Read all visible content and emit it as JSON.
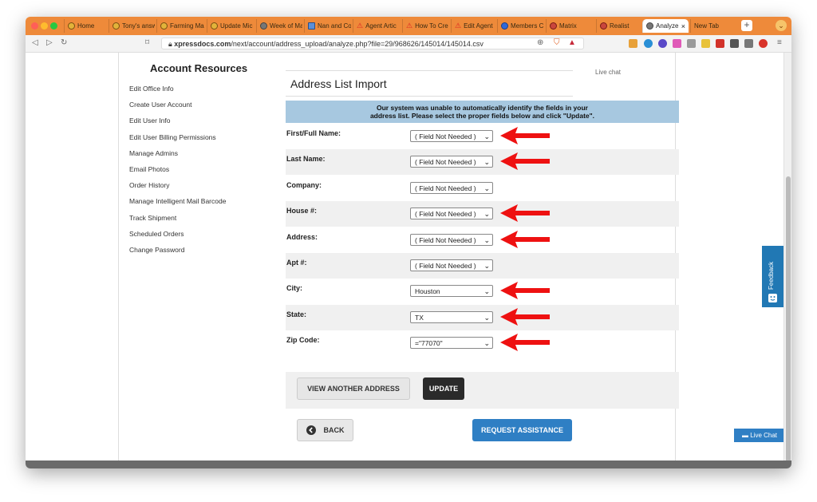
{
  "browser": {
    "tabs": [
      {
        "label": "Home",
        "icon": "chrome-icon"
      },
      {
        "label": "Tony's answ",
        "icon": "smiley-icon"
      },
      {
        "label": "Farming Ma",
        "icon": "chrome-icon"
      },
      {
        "label": "Update Mic",
        "icon": "chrome-icon"
      },
      {
        "label": "Week of Ma",
        "icon": "gear-icon"
      },
      {
        "label": "Nan and Co",
        "icon": "doc-icon"
      },
      {
        "label": "Agent Artic",
        "icon": "warning-icon"
      },
      {
        "label": "How To Cre",
        "icon": "warning-icon"
      },
      {
        "label": "Edit Agent",
        "icon": "warning-icon"
      },
      {
        "label": "Members C",
        "icon": "members-icon"
      },
      {
        "label": "Matrix",
        "icon": "matrix-icon"
      },
      {
        "label": "Realist",
        "icon": "realist-icon"
      },
      {
        "label": "Analyze",
        "icon": "globe-icon",
        "active": true
      },
      {
        "label": "New Tab",
        "icon": ""
      }
    ],
    "url_host": "xpressdocs.com",
    "url_path": "/next/account/address_upload/analyze.php?file=29/968626/145014/145014.csv",
    "tab_close_symbol": "×",
    "new_tab_symbol": "+"
  },
  "sidebar": {
    "title": "Account Resources",
    "items": [
      "Edit Office Info",
      "Create User Account",
      "Edit User Info",
      "Edit User Billing Permissions",
      "Manage Admins",
      "Email Photos",
      "Order History",
      "Manage Intelligent Mail Barcode",
      "Track Shipment",
      "Scheduled Orders",
      "Change Password"
    ]
  },
  "live_chat_link": "Live chat",
  "main": {
    "title": "Address List Import",
    "notice_line1": "Our system was unable to automatically identify the fields in your",
    "notice_line2": "address list. Please select the proper fields below and click \"Update\".",
    "fields": [
      {
        "label": "First/Full Name:",
        "value": "( Field Not Needed )",
        "arrow": true
      },
      {
        "label": "Last Name:",
        "value": "( Field Not Needed )",
        "arrow": true
      },
      {
        "label": "Company:",
        "value": "( Field Not Needed )",
        "arrow": false
      },
      {
        "label": "House #:",
        "value": "( Field Not Needed )",
        "arrow": true
      },
      {
        "label": "Address:",
        "value": "( Field Not Needed )",
        "arrow": true
      },
      {
        "label": "Apt #:",
        "value": "( Field Not Needed )",
        "arrow": false
      },
      {
        "label": "City:",
        "value": "Houston",
        "arrow": true
      },
      {
        "label": "State:",
        "value": "TX",
        "arrow": true
      },
      {
        "label": "Zip Code:",
        "value": "=\"77070\"",
        "arrow": true
      }
    ],
    "buttons": {
      "view_another": "VIEW ANOTHER ADDRESS",
      "update": "UPDATE",
      "back": "BACK",
      "request_assistance": "REQUEST ASSISTANCE"
    }
  },
  "feedback_label": "Feedback",
  "live_chat_button": "Live Chat",
  "colors": {
    "tabbar": "#ee8a3a",
    "notice_bg": "#a7c8e0",
    "primary_blue": "#2f7fc4",
    "arrow_red": "#ee1111"
  }
}
